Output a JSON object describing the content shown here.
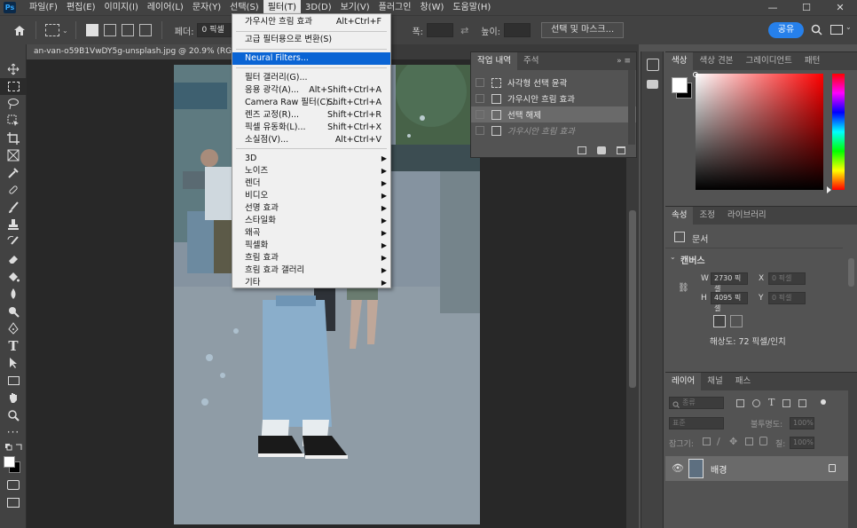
{
  "menubar": {
    "items": [
      "파일(F)",
      "편집(E)",
      "이미지(I)",
      "레이어(L)",
      "문자(Y)",
      "선택(S)",
      "필터(T)",
      "3D(D)",
      "보기(V)",
      "플러그인",
      "창(W)",
      "도움말(H)"
    ],
    "active_index": 6
  },
  "options_bar": {
    "feather_label": "페더:",
    "feather_value": "0 픽셀",
    "width_label": "폭:",
    "height_label": "높이:",
    "select_mask_label": "선택 및 마스크...",
    "share_label": "공유"
  },
  "document": {
    "tab_title": "an-van-o59B1VwDY5g-unsplash.jpg @ 20.9% (RGB/8) *"
  },
  "filter_menu": {
    "last_filter": {
      "label": "가우시안 흐림 효과",
      "shortcut": "Alt+Ctrl+F"
    },
    "convert_smart": "고급 필터용으로 변환(S)",
    "neural": "Neural Filters...",
    "group1": [
      {
        "label": "필터 갤러리(G)...",
        "shortcut": ""
      },
      {
        "label": "응용 광각(A)...",
        "shortcut": "Alt+Shift+Ctrl+A"
      },
      {
        "label": "Camera Raw 필터(C)...",
        "shortcut": "Shift+Ctrl+A"
      },
      {
        "label": "렌즈 교정(R)...",
        "shortcut": "Shift+Ctrl+R"
      },
      {
        "label": "픽셀 유동화(L)...",
        "shortcut": "Shift+Ctrl+X"
      },
      {
        "label": "소실점(V)...",
        "shortcut": "Alt+Ctrl+V"
      }
    ],
    "submenus": [
      "3D",
      "노이즈",
      "렌더",
      "비디오",
      "선명 효과",
      "스타일화",
      "왜곡",
      "픽셀화",
      "흐림 효과",
      "흐림 효과 갤러리",
      "기타"
    ]
  },
  "history_panel": {
    "tabs": [
      "작업 내역",
      "주석"
    ],
    "items": [
      {
        "label": "사각형 선택 윤곽",
        "state": "normal",
        "icon": "marquee-icon"
      },
      {
        "label": "가우시안 흐림 효과",
        "state": "normal",
        "icon": "document-icon"
      },
      {
        "label": "선택 해제",
        "state": "selected",
        "icon": "document-icon"
      },
      {
        "label": "가우시안 흐림 효과",
        "state": "dimmed",
        "icon": "document-icon"
      }
    ]
  },
  "color_panel": {
    "tabs": [
      "색상",
      "색상 견본",
      "그레이디언트",
      "패턴"
    ],
    "foreground_color": "#ffffff",
    "background_color": "#000000"
  },
  "properties_panel": {
    "tabs": [
      "속성",
      "조정",
      "라이브러리"
    ],
    "document_label": "문서",
    "canvas_label": "캔버스",
    "w_label": "W",
    "w_value": "2730 픽셀",
    "h_label": "H",
    "h_value": "4095 픽셀",
    "x_label": "X",
    "y_label": "Y",
    "x_placeholder": "0 픽셀",
    "y_placeholder": "0 픽셀",
    "resolution": "해상도: 72 픽셀/인치"
  },
  "layers_panel": {
    "tabs": [
      "레이어",
      "채널",
      "패스"
    ],
    "search_placeholder": "종류",
    "blend_mode": "표준",
    "opacity_label": "불투명도:",
    "opacity_value": "100%",
    "lock_label": "잠그기:",
    "fill_label": "칠:",
    "fill_value": "100%",
    "layers": [
      {
        "name": "배경",
        "visible": true,
        "locked": true
      }
    ]
  }
}
